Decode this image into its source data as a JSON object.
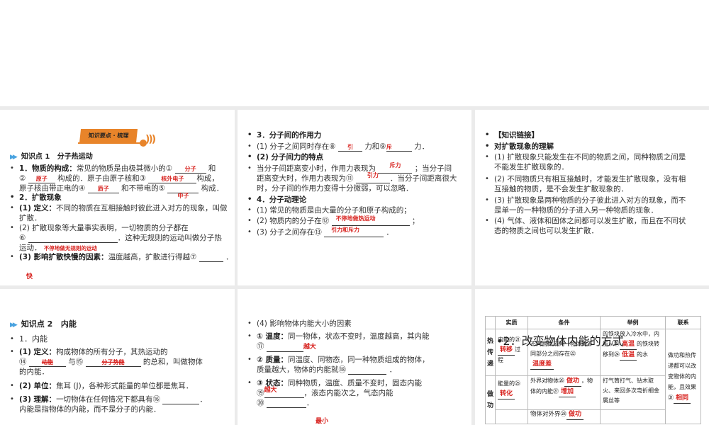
{
  "s1": {
    "banner": "知识要点 · 梳理",
    "heading_no": "知识点 1",
    "heading": "分子热运动",
    "l1a": "1．",
    "l1b": "物质的构成：",
    "l1c": "常见的物质是由极其微小的①",
    "a1": "分子",
    "l1d": "和",
    "l2a": "②",
    "a2": "原子",
    "l2b": "构成的．原子由原子核和③",
    "a3": "核外电子",
    "l2c": "构成，",
    "l3a": "原子核由带正电的④",
    "a4": "质子",
    "l3b": "和不带电的⑤",
    "a5": "中子",
    "l3c": "构成．",
    "l4": "2．扩散现象",
    "l5a": "(1) 定义：",
    "l5b": "不同的物质在互相接触时彼此进入对方的现象，叫做",
    "l6": "扩散．",
    "l7": "(2) 扩散现象等大量事实表明，一切物质的分子都在",
    "l8a": "⑥",
    "l8b": "．这种无规则的运动叫做分子热",
    "l9": "运动．",
    "a6": "不停地做无规则的运动",
    "l10a": "(3) 影响扩散快慢的因素：",
    "l10b": "温度越高，扩散进行得越⑦",
    "l10c": "．",
    "a7": "快"
  },
  "s2": {
    "l1": "3．分子间的作用力",
    "l2a": "(1) 分子之间同时存在⑧",
    "a8": "引",
    "l2b": "力和⑨",
    "a9": "斥",
    "l2c": "力．",
    "l3": "(2) 分子间力的特点",
    "l4a": "当分子间距离变小时，作用力表现为",
    "a10": "斥力",
    "l4b": "；当分子间",
    "l5a": "距离变大时，作用力表现为⑪",
    "a11": "引力",
    "l5b": "．当分子间距离很大",
    "l6": "时，分子间的作用力变得十分微弱，可以忽略．",
    "l7": "4．分子动理论",
    "l8": "(1) 常见的物质是由大量的分子和原子构成的；",
    "l9a": "(2) 物质内的分子在⑫",
    "a12": "不停地做热运动",
    "l9b": "；",
    "l10a": "(3) 分子之间存在⑬",
    "a13": "引力和斥力",
    "l10b": "．"
  },
  "s3": {
    "l1": "【知识链接】",
    "l2": "对扩散现象的理解",
    "l3": "(1) 扩散现象只能发生在不同的物质之间，同种物质之间是",
    "l4": "不能发生扩散现象的．",
    "l5": "(2) 不同物质只有相互接触时，才能发生扩散现象，没有相",
    "l6": "互接触的物质，是不会发生扩散现象的．",
    "l7": "(3) 扩散现象是两种物质的分子彼此进入对方的现象，而不",
    "l8": "是单一的一种物质的分子进入另一种物质的现象．",
    "l9": "(4) 气体、液体和固体之间都可以发生扩散，而且在不同状",
    "l10": "态的物质之间也可以发生扩散．"
  },
  "s4": {
    "heading_no": "知识点 2",
    "heading": "内能",
    "l1": "1．内能",
    "l2a": "(1) 定义：",
    "l2b": "构成物体的所有分子，其热运动的",
    "l3a": "⑭",
    "a14": "动能",
    "l3b": "与⑮",
    "a15": "分子势能",
    "l3c": "的总和，叫做物体",
    "l4": "的内能．",
    "l5a": "(2) 单位：",
    "l5b": "焦耳 (J)，各种形式能量的单位都是焦耳．",
    "l6a": "(3) 理解：",
    "l6b": "一切物体在任何情况下都具有⑯",
    "l6c": "．",
    "l7": "内能是指物体的内能，而不是分子的内能．"
  },
  "s5": {
    "l1": "(4) 影响物体内能大小的因素",
    "l2a": "① 温度：",
    "l2b": "同一物体，状态不变时，温度越高，其内能",
    "l3a": "⑰",
    "a17": "越大",
    "l4a": "② 质量：",
    "l4b": "同温度、同物态，同一种物质组成的物体，",
    "l5a": "质量越大，物体的内能就⑱",
    "l5b": "．",
    "a18": "越大",
    "l6a": "③ 状态：",
    "l6b": "同种物质，温度、质量不变时，固态内能",
    "l7a": "⑲",
    "l7b": "，液态内能次之，气态内能",
    "l8a": "⑳",
    "l8b": "．",
    "a20": "最小"
  },
  "s6": {
    "overlay": "•2．改变物体内能的方式",
    "headers": [
      "",
      "实质",
      "条件",
      "举例",
      "联系"
    ],
    "r1": {
      "c0": "热传递",
      "c1a": "内能的㉑",
      "c1ans": "转移",
      "c1b": "过程",
      "c2a": "不同物体或同一物体的不同部分之间存在㉒",
      "c2ans": "温度差",
      "c3a": "的铁块放入冷水中，内能从㉓",
      "c3ans1": "高温",
      "c3b": "的铁块转移到㉔",
      "c3ans2": "低温",
      "c3c": "的水",
      "c4a": "做功和热传递都可以改变物体的内能，且效果㉛",
      "c4ans": "相同"
    },
    "r2": {
      "c0": "做功",
      "c1a": "能量的㉕",
      "c1ans": "转化",
      "c2a": "外界对物体㉖",
      "c2ans1": "做功",
      "c2b": "，物体的内能㉗",
      "c2ans2": "增加",
      "c3": "打气筒打气、钻木取火、来回多次弯折细金属丝等"
    },
    "r3": {
      "c2a": "物体对外界㉘",
      "c2ans": "做功"
    }
  }
}
